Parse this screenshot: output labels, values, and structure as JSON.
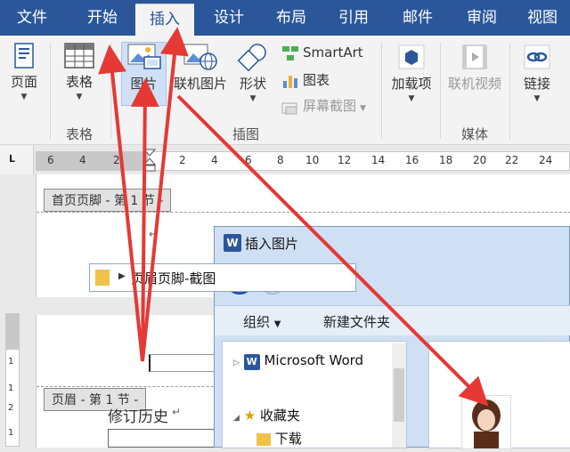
{
  "ribbon_tabs": [
    "文件",
    "开始",
    "插入",
    "设计",
    "布局",
    "引用",
    "邮件",
    "审阅",
    "视图"
  ],
  "active_tab": "插入",
  "ribbon": {
    "page_btn": "页面",
    "table_btn": "表格",
    "table_group": "表格",
    "picture_btn": "图片",
    "online_picture_btn": "联机图片",
    "shapes_btn": "形状",
    "smartart_btn": "SmartArt",
    "chart_btn": "图表",
    "screenshot_btn": "屏幕截图",
    "illustrations_group": "插图",
    "addins_btn": "加载项",
    "online_video_btn": "联机视频",
    "media_group": "媒体",
    "link_btn": "链接"
  },
  "ruler": {
    "corner": "L",
    "ticks": [
      "6",
      "4",
      "2",
      "2",
      "4",
      "6",
      "8",
      "10",
      "12",
      "14",
      "16",
      "18",
      "20",
      "22",
      "24"
    ],
    "vticks": [
      "1",
      "1",
      "2",
      "1"
    ]
  },
  "document": {
    "first_footer_label": "首页页脚 - 第 1 节 -",
    "header_label": "页眉 - 第 1 节 -",
    "body_text": "修订历史",
    "para_mark": "↵"
  },
  "dialog": {
    "title": "插入图片",
    "word_icon_letter": "W",
    "address_path": "页眉页脚-截图",
    "organize": "组织",
    "new_folder": "新建文件夹",
    "tree_items": [
      "Microsoft Word",
      "收藏夹",
      "下载"
    ]
  },
  "colors": {
    "ribbon_blue": "#2b579a",
    "arrow_red": "#e53935"
  }
}
